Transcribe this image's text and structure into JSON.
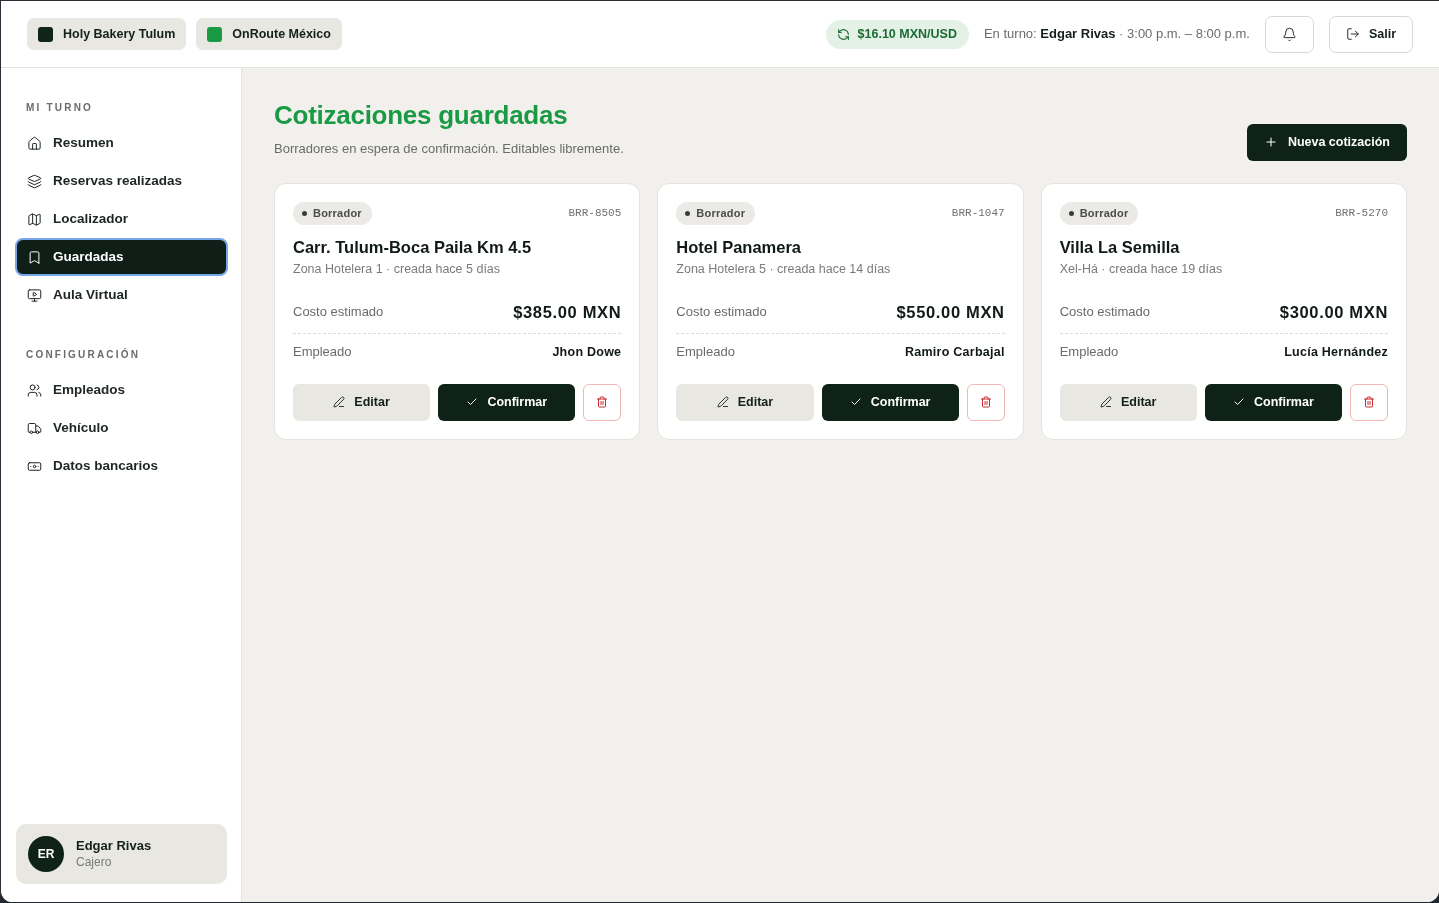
{
  "header": {
    "workspaces": [
      {
        "label": "Holy Bakery Tulum",
        "color": "#10241a"
      },
      {
        "label": "OnRoute México",
        "color": "#1a9a44"
      }
    ],
    "exchange_rate": "$16.10 MXN/USD",
    "shift": "En turno: **Edgar Rivas** · 3:00 p.m. – 8:00 p.m.",
    "logout": "Salir"
  },
  "sidebar": {
    "sections": [
      {
        "title": "MI TURNO",
        "items": [
          {
            "label": "Resumen",
            "selected": false
          },
          {
            "label": "Reservas realizadas",
            "selected": false
          },
          {
            "label": "Localizador",
            "selected": false
          },
          {
            "label": "Guardadas",
            "selected": true
          },
          {
            "label": "Aula Virtual",
            "selected": false
          }
        ]
      },
      {
        "title": "CONFIGURACIÓN",
        "items": [
          {
            "label": "Empleados",
            "selected": false
          },
          {
            "label": "Vehículo",
            "selected": false
          },
          {
            "label": "Datos bancarios",
            "selected": false
          }
        ]
      }
    ],
    "user": {
      "initials": "ER",
      "name": "Edgar Rivas",
      "role": "Cajero"
    }
  },
  "main": {
    "title": "Cotizaciones guardadas",
    "subtitle": "Borradores en espera de confirmación. Editables libremente.",
    "new_button": "Nueva cotización",
    "quotes": [
      {
        "status": "Borrador",
        "id": "BRR-8505",
        "title": "Carr. Tulum-Boca Paila Km 4.5",
        "meta": "Zona Hotelera 1 · creada hace 5 días",
        "cost_label": "Costo estimado",
        "cost": "$385.00 MXN",
        "employee_label": "Empleado",
        "employee": "Jhon Dowe",
        "edit": "Editar",
        "confirm": "Confirmar"
      },
      {
        "status": "Borrador",
        "id": "BRR-1047",
        "title": "Hotel Panamera",
        "meta": "Zona Hotelera 5 · creada hace 14 días",
        "cost_label": "Costo estimado",
        "cost": "$550.00 MXN",
        "employee_label": "Empleado",
        "employee": "Ramiro Carbajal",
        "edit": "Editar",
        "confirm": "Confirmar"
      },
      {
        "status": "Borrador",
        "id": "BRR-5270",
        "title": "Villa La Semilla",
        "meta": "Xel-Há · creada hace 19 días",
        "cost_label": "Costo estimado",
        "cost": "$300.00 MXN",
        "employee_label": "Empleado",
        "employee": "Lucía Hernández",
        "edit": "Editar",
        "confirm": "Confirmar"
      }
    ]
  }
}
